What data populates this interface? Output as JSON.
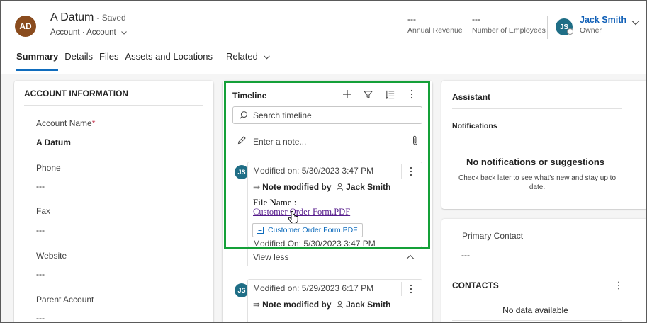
{
  "record": {
    "initials": "AD",
    "name": "A Datum",
    "saved_status": "- Saved",
    "entity_type": "Account · Account"
  },
  "header_fields": [
    {
      "value": "---",
      "label": "Annual Revenue"
    },
    {
      "value": "---",
      "label": "Number of Employees"
    }
  ],
  "owner": {
    "initials": "JS",
    "name": "Jack Smith",
    "label": "Owner"
  },
  "tabs": [
    "Summary",
    "Details",
    "Files",
    "Assets and Locations",
    "Related"
  ],
  "account_info": {
    "title": "ACCOUNT INFORMATION",
    "fields": [
      {
        "label": "Account Name",
        "required_mark": "*",
        "value": "A Datum"
      },
      {
        "label": "Phone",
        "value": "---"
      },
      {
        "label": "Fax",
        "value": "---"
      },
      {
        "label": "Website",
        "value": "---"
      },
      {
        "label": "Parent Account",
        "value": "---"
      }
    ]
  },
  "timeline": {
    "title": "Timeline",
    "search_placeholder": "Search timeline",
    "note_placeholder": "Enter a note...",
    "posts": [
      {
        "initials": "JS",
        "modified": "Modified on: 5/30/2023 3:47 PM",
        "subtitle": "Note modified by",
        "author": "Jack Smith",
        "body_label": "File Name :",
        "body_link": "Customer Order Form.PDF",
        "attachment": "Customer Order Form.PDF",
        "footer": "Modified On: 5/30/2023 3:47 PM",
        "toggle": "View less"
      },
      {
        "initials": "JS",
        "modified": "Modified on: 5/29/2023 6:17 PM",
        "subtitle": "Note modified by",
        "author": "Jack Smith"
      }
    ]
  },
  "assistant": {
    "title": "Assistant",
    "notifications_label": "Notifications",
    "empty_title": "No notifications or suggestions",
    "empty_text": "Check back later to see what's new and stay up to date."
  },
  "primary_contact": {
    "label": "Primary Contact",
    "value": "---"
  },
  "contacts": {
    "title": "CONTACTS",
    "empty": "No data available"
  },
  "colors": {
    "accent": "#0f6cbd",
    "highlight": "#14a038",
    "avatar_account": "#8a4c1e",
    "avatar_user": "#1f6e86"
  }
}
